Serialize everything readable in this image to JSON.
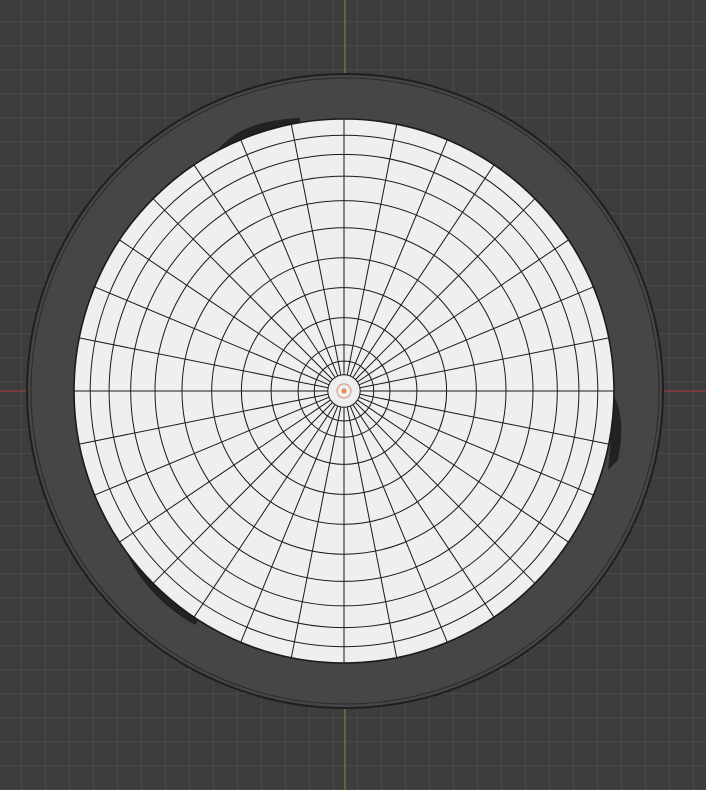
{
  "viewport": {
    "background": "#3d3d3d",
    "grid_line_color": "#474747",
    "x_axis_color": "#9b3a3f",
    "y_axis_color": "#6f8b2f"
  },
  "mesh": {
    "ring_color": "#474545",
    "ring_edge_color": "#1f1f1f",
    "face_color": "#efefef",
    "wire_color": "#1a1a1a",
    "seam_artifact_color": "#1e1e1e",
    "origin_color": "#e98a4a",
    "radial_segments": 32,
    "concentric_rings": 11
  }
}
